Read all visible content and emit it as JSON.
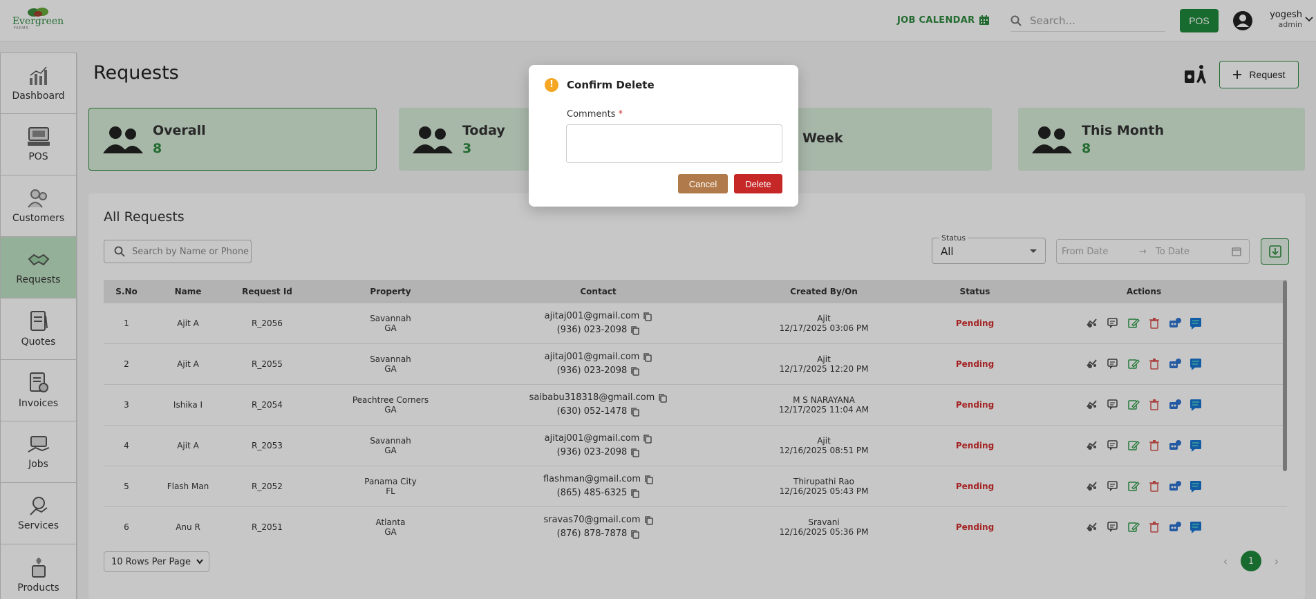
{
  "app": {
    "brand": "Evergreen",
    "brand_sub": "FARMS"
  },
  "header": {
    "job_calendar": "JOB CALENDAR",
    "search_placeholder": "Search...",
    "pos_label": "POS",
    "user_name": "yogesh",
    "user_role": "admin"
  },
  "sidebar": {
    "items": [
      {
        "label": "Dashboard",
        "icon": "chart-icon"
      },
      {
        "label": "POS",
        "icon": "pos-terminal-icon"
      },
      {
        "label": "Customers",
        "icon": "customers-icon"
      },
      {
        "label": "Requests",
        "icon": "handshake-icon",
        "active": true
      },
      {
        "label": "Quotes",
        "icon": "quote-icon"
      },
      {
        "label": "Invoices",
        "icon": "invoice-icon"
      },
      {
        "label": "Jobs",
        "icon": "jobs-icon"
      },
      {
        "label": "Services",
        "icon": "services-icon"
      },
      {
        "label": "Products",
        "icon": "products-icon"
      }
    ]
  },
  "page": {
    "title": "Requests",
    "request_button": "Request"
  },
  "cards": [
    {
      "title": "Overall",
      "value": "8"
    },
    {
      "title": "Today",
      "value": "3"
    },
    {
      "title": "Week",
      "value": ""
    },
    {
      "title": "This Month",
      "value": "8"
    }
  ],
  "panel": {
    "title": "All Requests",
    "search_placeholder": "Search by Name or Phone",
    "status_label": "Status",
    "status_value": "All",
    "from_date": "From Date",
    "to_date": "To Date",
    "arrow": "→"
  },
  "table": {
    "headers": [
      "S.No",
      "Name",
      "Request Id",
      "Property",
      "Contact",
      "Created By/On",
      "Status",
      "Actions"
    ],
    "rows": [
      {
        "sno": "1",
        "name": "Ajit A",
        "id": "R_2056",
        "city": "Savannah",
        "state": "GA",
        "email": "ajitaj001@gmail.com",
        "phone": "(936) 023-2098",
        "by": "Ajit",
        "on": "12/17/2025 03:06 PM",
        "status": "Pending"
      },
      {
        "sno": "2",
        "name": "Ajit A",
        "id": "R_2055",
        "city": "Savannah",
        "state": "GA",
        "email": "ajitaj001@gmail.com",
        "phone": "(936) 023-2098",
        "by": "Ajit",
        "on": "12/17/2025 12:20 PM",
        "status": "Pending"
      },
      {
        "sno": "3",
        "name": "Ishika I",
        "id": "R_2054",
        "city": "Peachtree Corners",
        "state": "GA",
        "email": "saibabu318318@gmail.com",
        "phone": "(630) 052-1478",
        "by": "M S NARAYANA",
        "on": "12/17/2025 11:04 AM",
        "status": "Pending"
      },
      {
        "sno": "4",
        "name": "Ajit A",
        "id": "R_2053",
        "city": "Savannah",
        "state": "GA",
        "email": "ajitaj001@gmail.com",
        "phone": "(936) 023-2098",
        "by": "Ajit",
        "on": "12/16/2025 08:51 PM",
        "status": "Pending"
      },
      {
        "sno": "5",
        "name": "Flash Man",
        "id": "R_2052",
        "city": "Panama City",
        "state": "FL",
        "email": "flashman@gmail.com",
        "phone": "(865) 485-6325",
        "by": "Thirupathi Rao",
        "on": "12/16/2025 05:43 PM",
        "status": "Pending"
      },
      {
        "sno": "6",
        "name": "Anu R",
        "id": "R_2051",
        "city": "Atlanta",
        "state": "GA",
        "email": "sravas70@gmail.com",
        "phone": "(876) 878-7878",
        "by": "Sravani",
        "on": "12/16/2025 05:36 PM",
        "status": "Pending"
      }
    ]
  },
  "pagination": {
    "rows_per_page": "10 Rows Per Page",
    "current_page": "1",
    "prev": "‹",
    "next": "›"
  },
  "modal": {
    "title": "Confirm Delete",
    "warn_glyph": "!",
    "comments_label": "Comments",
    "required_mark": "*",
    "cancel": "Cancel",
    "delete": "Delete"
  },
  "colors": {
    "brand_green": "#2d8a3e",
    "pending_red": "#d32f2f",
    "card_bg": "#d6ebd8",
    "cancel_brown": "#b07a4a",
    "delete_red": "#c62828"
  }
}
